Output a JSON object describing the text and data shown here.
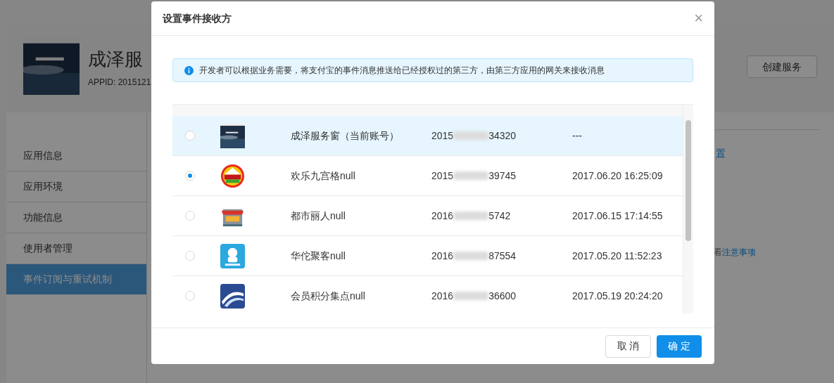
{
  "page": {
    "app_title": "成泽服",
    "appid": "APPID: 2015121",
    "create_button": "创建服务",
    "link_fragment": "置",
    "note_prefix": "看",
    "note_link": "注意事项"
  },
  "sidebar": {
    "items": [
      {
        "label": "应用信息",
        "selected": false
      },
      {
        "label": "应用环境",
        "selected": false
      },
      {
        "label": "功能信息",
        "selected": false
      },
      {
        "label": "使用者管理",
        "selected": false
      },
      {
        "label": "事件订阅与重试机制",
        "selected": true
      }
    ]
  },
  "dialog": {
    "title": "设置事件接收方",
    "close": "×",
    "info": "开发者可以根据业务需要，将支付宝的事件消息推送给已经授权过的第三方，由第三方应用的网关来接收消息",
    "rows": [
      {
        "selected": false,
        "highlighted": true,
        "name": "成泽服务窗（当前账号）",
        "id_start": "2015",
        "id_end": "34320",
        "date": "---"
      },
      {
        "selected": true,
        "highlighted": false,
        "name": "欢乐九宫格null",
        "id_start": "2015",
        "id_end": "39745",
        "date": "2017.06.20 16:25:09"
      },
      {
        "selected": false,
        "highlighted": false,
        "name": "都市丽人null",
        "id_start": "2016",
        "id_end": "5742",
        "date": "2017.06.15 17:14:55"
      },
      {
        "selected": false,
        "highlighted": false,
        "name": "华佗聚客null",
        "id_start": "2016",
        "id_end": "87554",
        "date": "2017.05.20 11:52:23"
      },
      {
        "selected": false,
        "highlighted": false,
        "name": "会员积分集点null",
        "id_start": "2016",
        "id_end": "36600",
        "date": "2017.05.19 20:24:20"
      }
    ],
    "buttons": [
      {
        "label": "取 消",
        "kind": "secondary"
      },
      {
        "label": "确 定",
        "kind": "primary"
      }
    ]
  }
}
